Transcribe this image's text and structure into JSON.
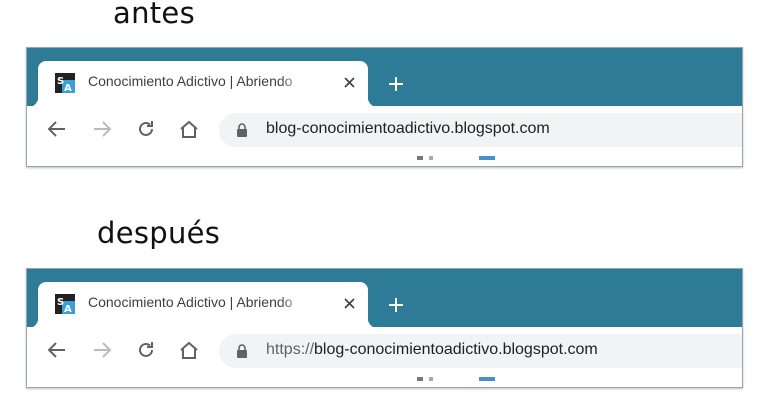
{
  "before": {
    "caption": "antes",
    "tab_title": "Conocimiento Adictivo | Abriendo",
    "url_scheme": "",
    "url_host": "blog-conocimientoadictivo.blogspot.com"
  },
  "after": {
    "caption": "después",
    "tab_title": "Conocimiento Adictivo | Abriendo",
    "url_scheme": "https://",
    "url_host": "blog-conocimientoadictivo.blogspot.com"
  },
  "icons": {
    "favicon": "blog-favicon-icon",
    "close": "close-icon",
    "new_tab": "plus-icon",
    "back": "back-arrow-icon",
    "forward": "forward-arrow-icon",
    "reload": "reload-icon",
    "home": "home-icon",
    "lock": "lock-icon"
  },
  "colors": {
    "tab_strip": "#2d7b97",
    "omnibox": "#f1f3f4",
    "text": "#202124"
  }
}
